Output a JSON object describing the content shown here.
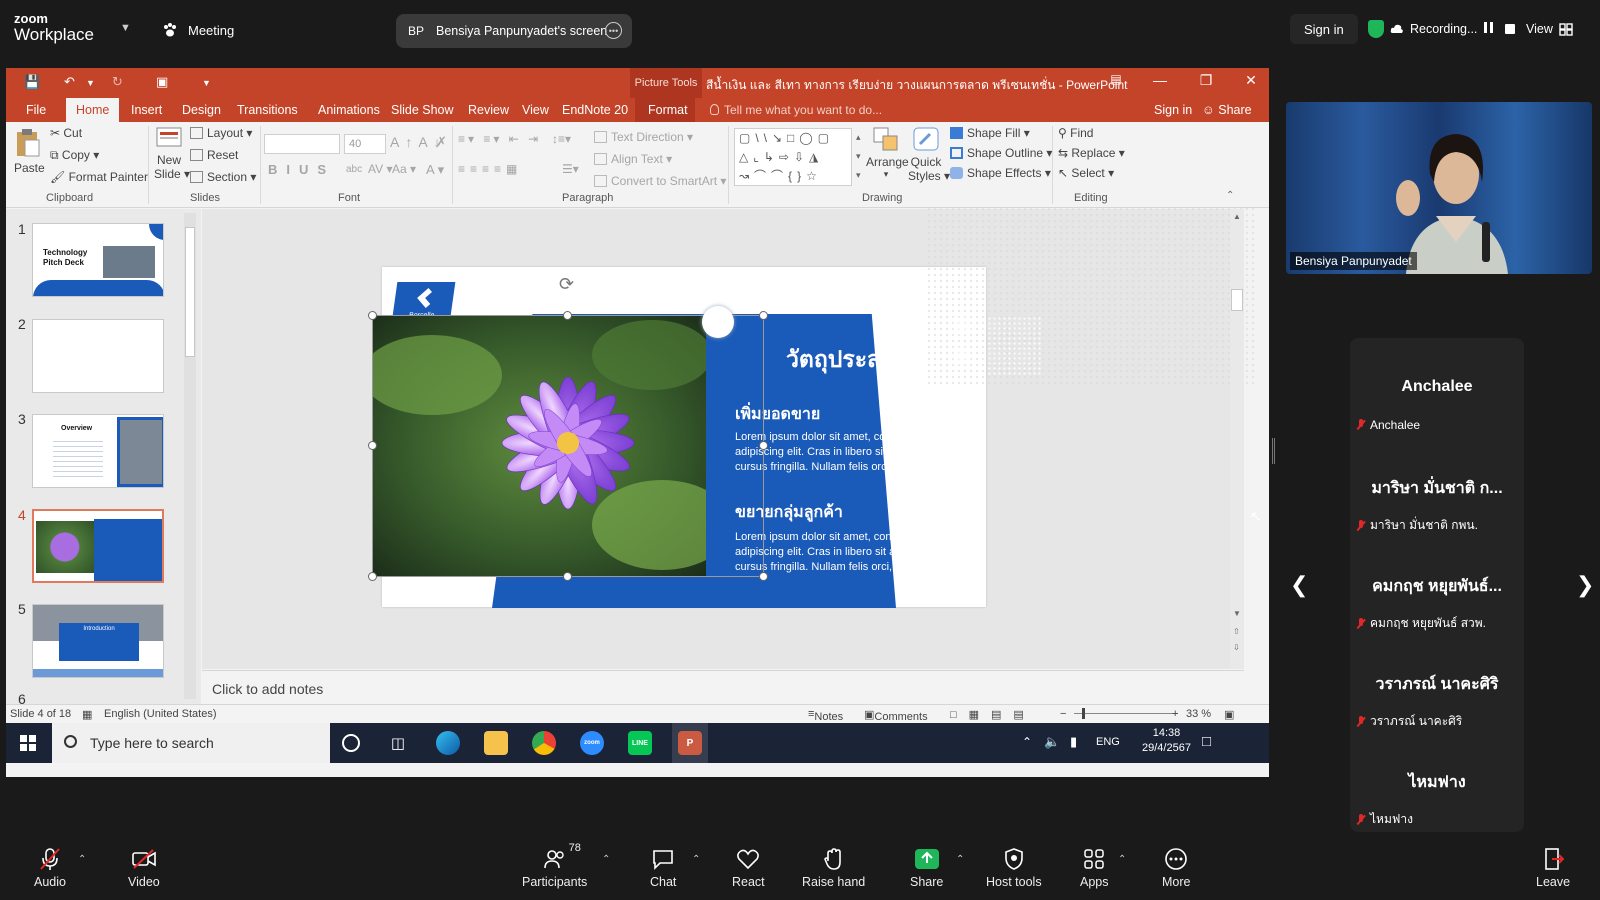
{
  "zoom": {
    "logo_line1": "zoom",
    "logo_line2": "Workplace",
    "meeting_label": "Meeting",
    "share_initials": "BP",
    "share_label": "Bensiya Panpunyadet's screen",
    "sign_in": "Sign in",
    "recording": "Recording...",
    "view": "View"
  },
  "ppt": {
    "picture_tools": "Picture Tools",
    "doc_title": "สีน้ำเงิน และ สีเทา ทางการ เรียบง่าย วางแผนการตลาด พรีเซนเทชั่น - PowerPoint",
    "tabs": [
      "File",
      "Home",
      "Insert",
      "Design",
      "Transitions",
      "Animations",
      "Slide Show",
      "Review",
      "View",
      "EndNote 20",
      "Format"
    ],
    "tell_me": "Tell me what you want to do...",
    "sign_in": "Sign in",
    "share": "Share",
    "ribbon": {
      "paste": "Paste",
      "cut": "Cut",
      "copy": "Copy",
      "format_painter": "Format Painter",
      "clipboard": "Clipboard",
      "new_slide_1": "New",
      "new_slide_2": "Slide",
      "layout": "Layout",
      "reset": "Reset",
      "section": "Section",
      "slides": "Slides",
      "font_size": "40",
      "font": "Font",
      "text_direction": "Text Direction",
      "align_text": "Align Text",
      "convert_smartart": "Convert to SmartArt",
      "paragraph": "Paragraph",
      "arrange": "Arrange",
      "quick_styles_1": "Quick",
      "quick_styles_2": "Styles",
      "shape_fill": "Shape Fill",
      "shape_outline": "Shape Outline",
      "shape_effects": "Shape Effects",
      "drawing": "Drawing",
      "find": "Find",
      "replace": "Replace",
      "select": "Select",
      "editing": "Editing"
    },
    "thumbnails": [
      {
        "num": "1",
        "title": "Technology Pitch Deck"
      },
      {
        "num": "2",
        "title": ""
      },
      {
        "num": "3",
        "title": "Overview"
      },
      {
        "num": "4",
        "title": ""
      },
      {
        "num": "5",
        "title": "Introduction"
      },
      {
        "num": "6",
        "title": ""
      }
    ],
    "slide": {
      "brand": "Borcelle",
      "title": "วัตถุประสงค์",
      "heading1": "เพิ่มยอดขาย",
      "body1": "Lorem ipsum dolor sit amet, consectetur adipiscing elit. Cras in libero sit amet nisl cursus fringilla. Nullam felis orci, maximus sit.",
      "heading2": "ขยายกลุ่มลูกค้า",
      "body2": "Lorem ipsum dolor sit amet, consectetur adipiscing elit. Cras in libero sit amet nisl cursus fringilla. Nullam felis orci, maximus sit."
    },
    "notes_placeholder": "Click to add notes",
    "status": {
      "slide_of": "Slide 4 of 18",
      "language": "English (United States)",
      "notes": "Notes",
      "comments": "Comments",
      "zoom": "33 %"
    }
  },
  "taskbar": {
    "search_placeholder": "Type here to search",
    "lang": "ENG",
    "time": "14:38",
    "date": "29/4/2567"
  },
  "video": {
    "name": "Bensiya Panpunyadet"
  },
  "participants": [
    {
      "big": "Anchalee",
      "small": "Anchalee"
    },
    {
      "big": "มาริษา มั่นชาติ ก...",
      "small": "มาริษา มั่นชาติ กพน."
    },
    {
      "big": "คมกฤช หยุยพันธ์...",
      "small": "คมกฤช หยุยพันธ์ สวพ."
    },
    {
      "big": "วราภรณ์ นาคะศิริ",
      "small": "วราภรณ์ นาคะศิริ"
    },
    {
      "big": "ไหมฟาง",
      "small": "ไหมฟาง"
    }
  ],
  "bottom_bar": {
    "audio": "Audio",
    "video": "Video",
    "participants": "Participants",
    "participants_count": "78",
    "chat": "Chat",
    "react": "React",
    "raise_hand": "Raise hand",
    "share": "Share",
    "host_tools": "Host tools",
    "apps": "Apps",
    "more": "More",
    "leave": "Leave"
  },
  "colors": {
    "ppt_accent": "#c4442a",
    "slide_blue": "#1a5ab8",
    "zoom_bg": "#1a1a1a",
    "share_green": "#1fb65a"
  }
}
